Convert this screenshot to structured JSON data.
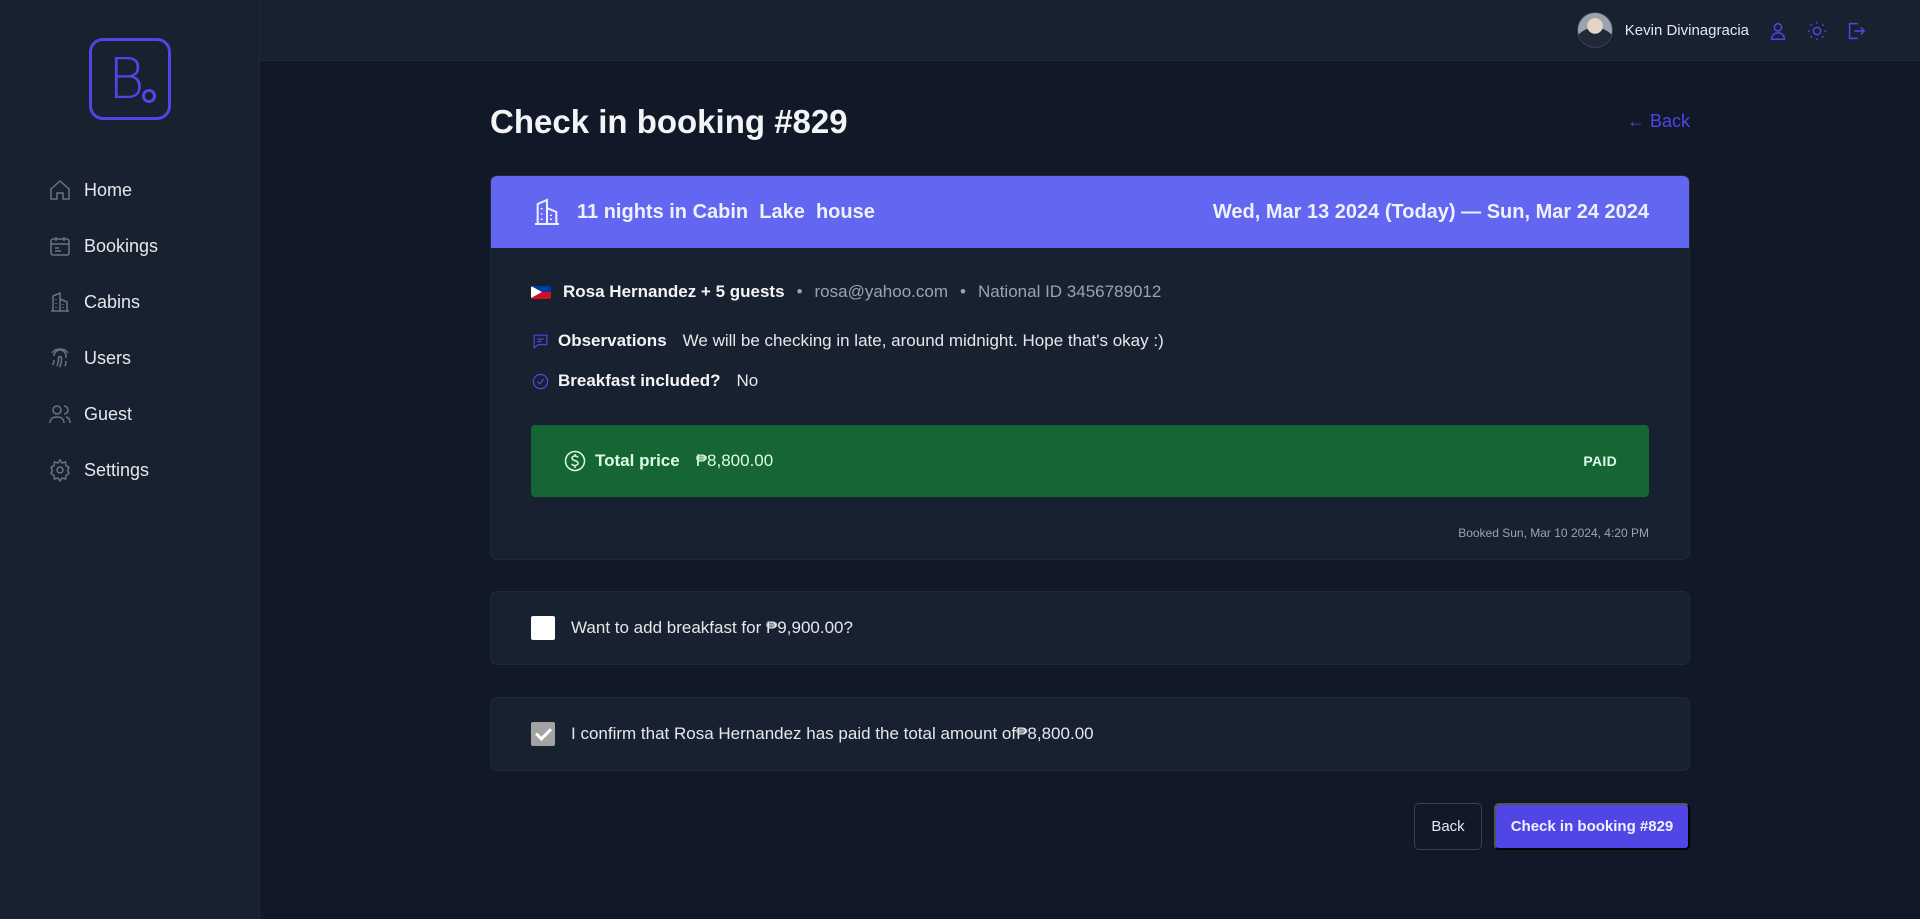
{
  "sidebar": {
    "logo_letter": "B",
    "items": [
      {
        "label": "Home",
        "icon": "home-icon"
      },
      {
        "label": "Bookings",
        "icon": "calendar-icon"
      },
      {
        "label": "Cabins",
        "icon": "building-icon"
      },
      {
        "label": "Users",
        "icon": "fingerprint-icon"
      },
      {
        "label": "Guest",
        "icon": "users-icon"
      },
      {
        "label": "Settings",
        "icon": "gear-icon"
      }
    ]
  },
  "header": {
    "user_name": "Kevin Divinagracia",
    "icons": [
      "user-icon",
      "sun-icon",
      "logout-icon"
    ]
  },
  "page": {
    "title": "Check in booking #829",
    "back_link": "← Back"
  },
  "booking": {
    "nights_text": "11 nights in Cabin  Lake  house",
    "dates": "Wed, Mar 13 2024 (Today) — Sun, Mar 24 2024",
    "guest": "Rosa Hernandez + 5 guests",
    "email": "rosa@yahoo.com",
    "national_id": "National ID 3456789012",
    "separator": "•",
    "observations_label": "Observations",
    "observations": "We will be checking in late, around midnight. Hope that's okay :)",
    "breakfast_label": "Breakfast included?",
    "breakfast_value": "No",
    "total_label": "Total price",
    "total_value": "₱8,800.00",
    "paid_status": "PAID",
    "booked_at": "Booked Sun, Mar 10 2024, 4:20 PM"
  },
  "options": {
    "add_breakfast": "Want to add breakfast for ₱9,900.00?",
    "add_breakfast_checked": false,
    "confirm_paid": "I confirm that Rosa Hernandez has paid the total amount of₱8,800.00",
    "confirm_paid_checked": true
  },
  "actions": {
    "back": "Back",
    "check_in": "Check in booking #829"
  },
  "colors": {
    "accent": "#4f46e5",
    "header_band": "#6366f1",
    "paid_green": "#166534"
  }
}
